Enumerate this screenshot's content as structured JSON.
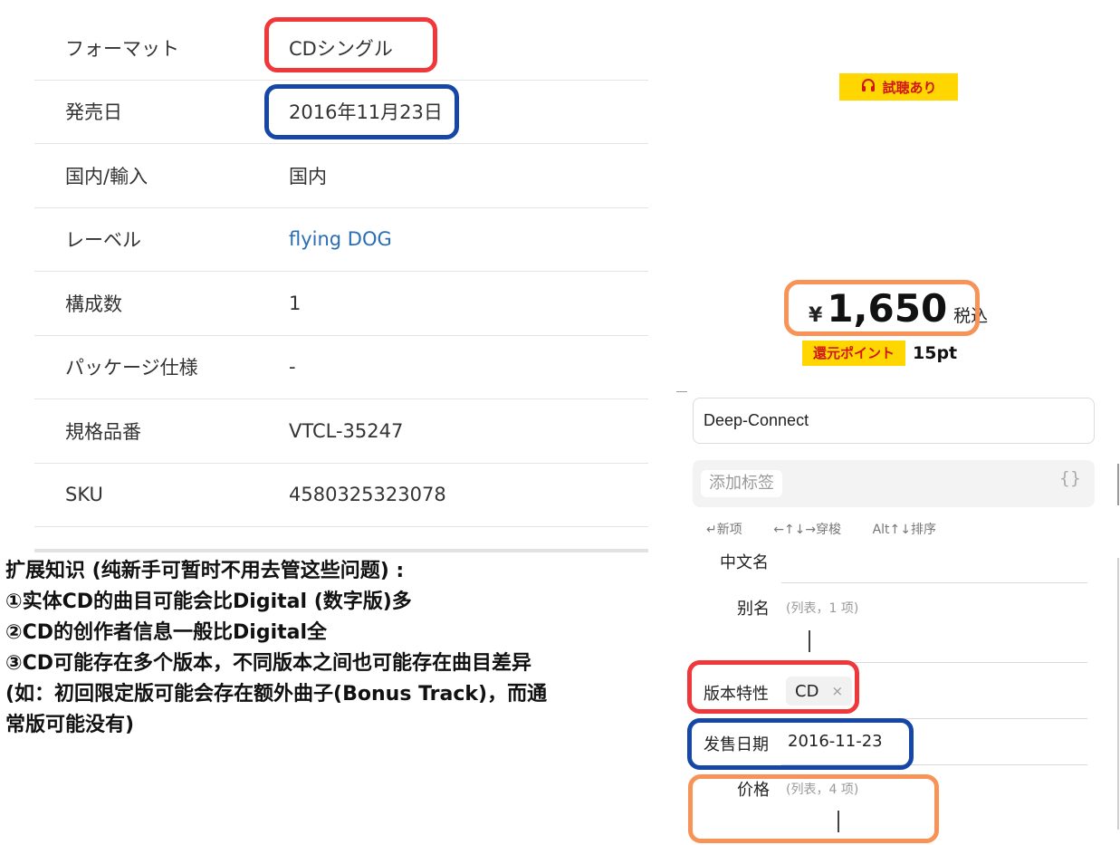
{
  "spec_table": {
    "rows": [
      {
        "label": "フォーマット",
        "value": "CDシングル"
      },
      {
        "label": "発売日",
        "value": "2016年11月23日"
      },
      {
        "label": "国内/輸入",
        "value": "国内"
      },
      {
        "label": "レーベル",
        "value": "flying DOG"
      },
      {
        "label": "構成数",
        "value": "1"
      },
      {
        "label": "パッケージ仕様",
        "value": "-"
      },
      {
        "label": "規格品番",
        "value": "VTCL-35247"
      },
      {
        "label": "SKU",
        "value": "4580325323078"
      }
    ]
  },
  "notes": [
    "扩展知识 (纯新手可暂时不用去管这些问题) :",
    "①实体CD的曲目可能会比Digital (数字版)多",
    "②CD的创作者信息一般比Digital全",
    "③CD可能存在多个版本，不同版本之间也可能存在曲目差异",
    "(如：初回限定版可能会存在额外曲子(Bonus Track)，而通",
    "常版可能没有)"
  ],
  "product": {
    "trial_badge": "試聴あり",
    "currency": "¥",
    "price": "1,650",
    "tax_label": "税込",
    "points_badge": "還元ポイント",
    "points_value": "15pt"
  },
  "form": {
    "title_value": "Deep-Connect",
    "tag_placeholder": "添加标签",
    "braces": "{}",
    "shortcuts": [
      "↵新项",
      "←↑↓→穿梭",
      "Alt↑↓排序"
    ],
    "fields": {
      "chinese_name": {
        "label": "中文名"
      },
      "alias": {
        "label": "别名",
        "hint": "(列表，1 项)"
      },
      "edition": {
        "label": "版本特性",
        "chip": "CD",
        "chip_remove": "×"
      },
      "release_date": {
        "label": "发售日期",
        "value": "2016-11-23"
      },
      "price": {
        "label": "价格",
        "hint": "(列表，4 项)"
      }
    }
  },
  "colors": {
    "red_highlight": "#f0383a",
    "blue_highlight": "#1747a6",
    "orange_highlight": "#f79356",
    "badge_yellow": "#ffd600",
    "link_blue": "#2a6db5"
  }
}
